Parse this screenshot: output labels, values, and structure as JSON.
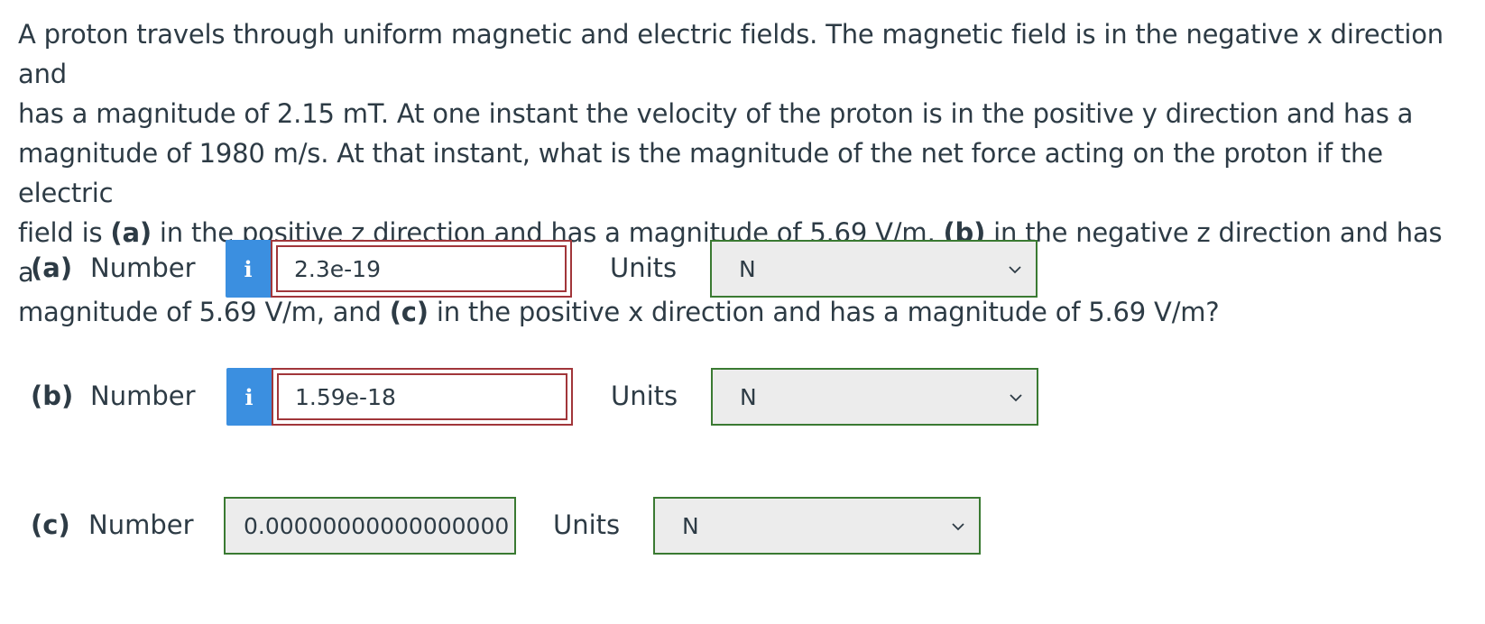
{
  "question": {
    "line1": "A proton travels through uniform magnetic and electric fields. The magnetic field is in the negative x direction and",
    "line2": "has a magnitude of 2.15 mT. At one instant the velocity of the proton is in the positive y direction and has a",
    "line3": "magnitude of 1980 m/s. At that instant, what is the magnitude of the net force acting on the proton if the electric",
    "line4a": "field is ",
    "line4b": "(a)",
    "line4c": " in the positive z direction and has a magnitude of 5.69 V/m, ",
    "line4d": "(b)",
    "line4e": " in the negative z direction and has a",
    "line5a": "magnitude of 5.69 V/m, and ",
    "line5b": "(c)",
    "line5c": " in the positive x direction and has a magnitude of 5.69 V/m?"
  },
  "parts": [
    {
      "label": "(a)",
      "number_label": "Number",
      "info": "i",
      "value": "2.3e-19",
      "units_label": "Units",
      "unit": "N"
    },
    {
      "label": "(b)",
      "number_label": "Number",
      "info": "i",
      "value": "1.59e-18",
      "units_label": "Units",
      "unit": "N"
    },
    {
      "label": "(c)",
      "number_label": "Number",
      "value": "0.00000000000000000",
      "units_label": "Units",
      "unit": "N"
    }
  ],
  "colors": {
    "info": "#3b8fe0",
    "incorrect": "#a1363a",
    "correct": "#3a7a32"
  }
}
